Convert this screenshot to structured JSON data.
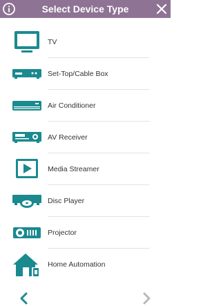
{
  "header": {
    "title": "Select Device Type",
    "background": "#8e7394",
    "info_icon": "info-circle-icon",
    "close_icon": "close-x-icon"
  },
  "accent_color": "#1a8a8f",
  "devices": [
    {
      "label": "TV",
      "icon": "tv-icon"
    },
    {
      "label": "Set-Top/Cable Box",
      "icon": "set-top-box-icon"
    },
    {
      "label": "Air Conditioner",
      "icon": "air-conditioner-icon"
    },
    {
      "label": "AV Receiver",
      "icon": "av-receiver-icon"
    },
    {
      "label": "Media Streamer",
      "icon": "media-streamer-icon"
    },
    {
      "label": "Disc Player",
      "icon": "disc-player-icon"
    },
    {
      "label": "Projector",
      "icon": "projector-icon"
    },
    {
      "label": "Home Automation",
      "icon": "home-automation-icon"
    }
  ],
  "footer": {
    "prev_icon": "chevron-left-icon",
    "next_icon": "chevron-right-icon",
    "prev_color": "#1a8a8f",
    "next_color": "#b8b8b8"
  }
}
